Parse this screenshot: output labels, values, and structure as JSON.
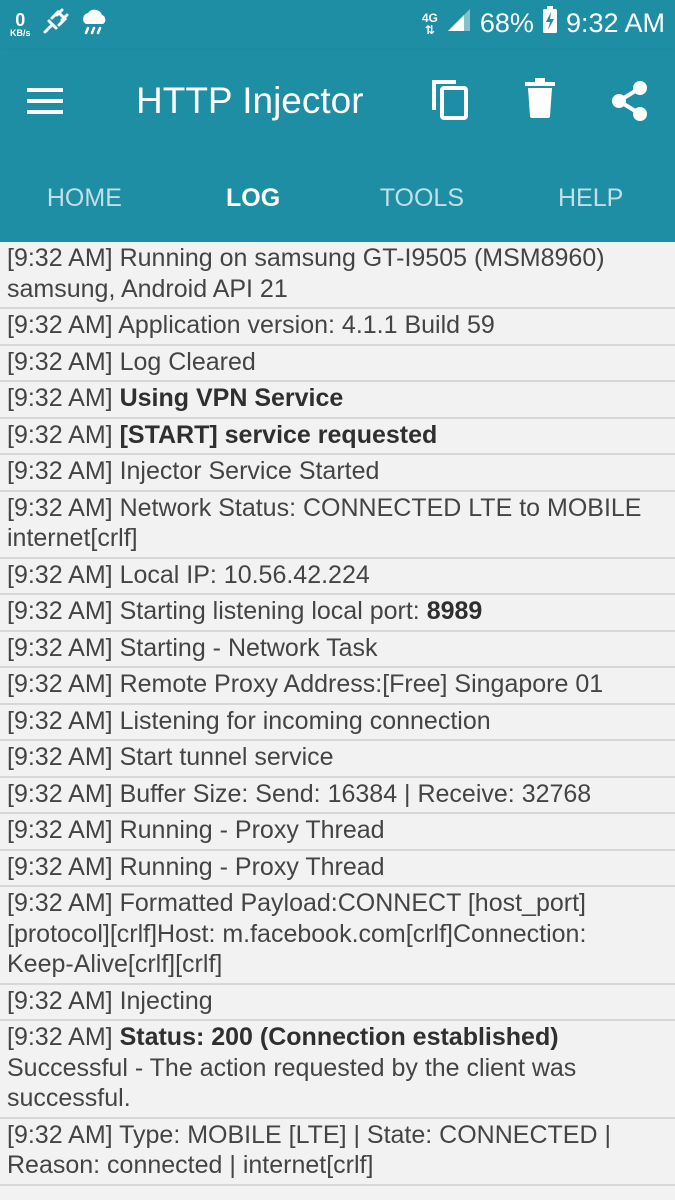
{
  "status_bar": {
    "speed_value": "0",
    "speed_unit": "KB/s",
    "network_type": "4G",
    "battery": "68%",
    "time": "9:32 AM"
  },
  "app_bar": {
    "title": "HTTP Injector",
    "background": "#1e8ea4"
  },
  "tabs": [
    {
      "label": "HOME",
      "active": false
    },
    {
      "label": "LOG",
      "active": true
    },
    {
      "label": "TOOLS",
      "active": false
    },
    {
      "label": "HELP",
      "active": false
    }
  ],
  "log": [
    {
      "time": "[9:32 AM]",
      "text": "Running on samsung GT-I9505 (MSM8960)",
      "cont": [
        "samsung, Android API 21"
      ]
    },
    {
      "time": "[9:32 AM]",
      "text": "Application version: 4.1.1 Build 59"
    },
    {
      "time": "[9:32 AM]",
      "text": "Log Cleared"
    },
    {
      "time": "[9:32 AM]",
      "bold": "Using VPN Service"
    },
    {
      "time": "[9:32 AM]",
      "bold": "[START] service requested"
    },
    {
      "time": "[9:32 AM]",
      "text": "Injector Service Started"
    },
    {
      "time": "[9:32 AM]",
      "text": "Network Status: CONNECTED LTE to MOBILE",
      "cont": [
        "internet[crlf]"
      ]
    },
    {
      "time": "[9:32 AM]",
      "text": "Local IP: 10.56.42.224"
    },
    {
      "time": "[9:32 AM]",
      "text": "Starting listening local port: ",
      "bold": "8989"
    },
    {
      "time": "[9:32 AM]",
      "text": "Starting - Network Task"
    },
    {
      "time": "[9:32 AM]",
      "text": "Remote Proxy Address:[Free] Singapore 01"
    },
    {
      "time": "[9:32 AM]",
      "text": "Listening for incoming connection"
    },
    {
      "time": "[9:32 AM]",
      "text": "Start tunnel service"
    },
    {
      "time": "[9:32 AM]",
      "text": "Buffer Size: Send: 16384 | Receive: 32768"
    },
    {
      "time": "[9:32 AM]",
      "text": "Running - Proxy Thread"
    },
    {
      "time": "[9:32 AM]",
      "text": "Running - Proxy Thread"
    },
    {
      "time": "[9:32 AM]",
      "text": "Formatted Payload:CONNECT [host_port]",
      "cont": [
        "[protocol][crlf]Host: m.facebook.com[crlf]Connection:",
        "Keep-Alive[crlf][crlf]"
      ]
    },
    {
      "time": "[9:32 AM]",
      "text": "Injecting"
    },
    {
      "time": "[9:32 AM]",
      "bold": "Status: 200 (Connection established)",
      "cont": [
        "Successful - The action requested by the client was",
        "successful."
      ]
    },
    {
      "time": "[9:32 AM]",
      "text": "Type: MOBILE [LTE] | State: CONNECTED |",
      "cont": [
        "Reason: connected | internet[crlf]"
      ]
    }
  ]
}
